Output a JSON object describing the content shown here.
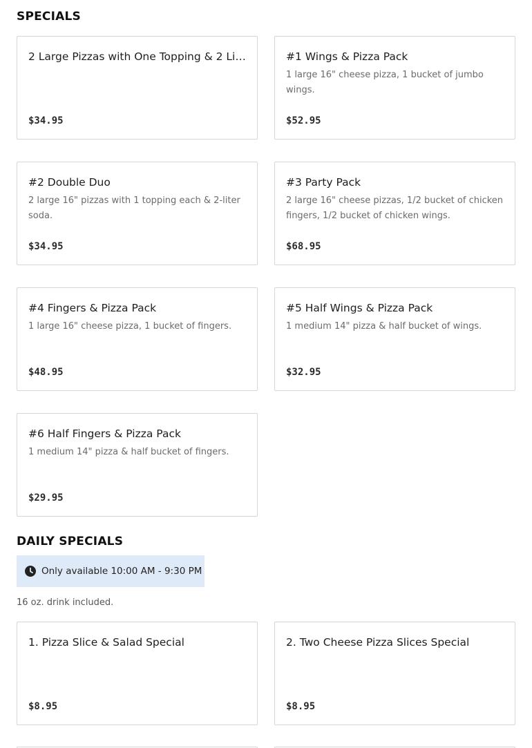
{
  "specials": {
    "heading": "SPECIALS",
    "items": [
      {
        "title": "2 Large Pizzas with One Topping & 2 Liter…",
        "description": "",
        "price": "$34.95"
      },
      {
        "title": "#1 Wings & Pizza Pack",
        "description": "1 large 16\" cheese pizza, 1 bucket of jumbo wings.",
        "price": "$52.95"
      },
      {
        "title": "#2 Double Duo",
        "description": "2 large 16\" pizzas with 1 topping each & 2-liter soda.",
        "price": "$34.95"
      },
      {
        "title": "#3 Party Pack",
        "description": "2 large 16\" cheese pizzas, 1/2 bucket of chicken fingers, 1/2 bucket of chicken wings.",
        "price": "$68.95"
      },
      {
        "title": "#4 Fingers & Pizza Pack",
        "description": "1 large 16\" cheese pizza, 1 bucket of fingers.",
        "price": "$48.95"
      },
      {
        "title": "#5 Half Wings & Pizza Pack",
        "description": "1 medium 14\" pizza & half bucket of wings.",
        "price": "$32.95"
      },
      {
        "title": "#6 Half Fingers & Pizza Pack",
        "description": "1 medium 14\" pizza & half bucket of fingers.",
        "price": "$29.95"
      }
    ]
  },
  "daily_specials": {
    "heading": "DAILY SPECIALS",
    "availability": {
      "icon": "clock-icon",
      "text": "Only available 10:00 AM - 9:30 PM",
      "bg_color": "#dfeaf8"
    },
    "note": "16 oz. drink included.",
    "items": [
      {
        "title": "1. Pizza Slice & Salad Special",
        "description": "",
        "price": "$8.95"
      },
      {
        "title": "2. Two Cheese Pizza Slices Special",
        "description": "",
        "price": "$8.95"
      }
    ]
  }
}
